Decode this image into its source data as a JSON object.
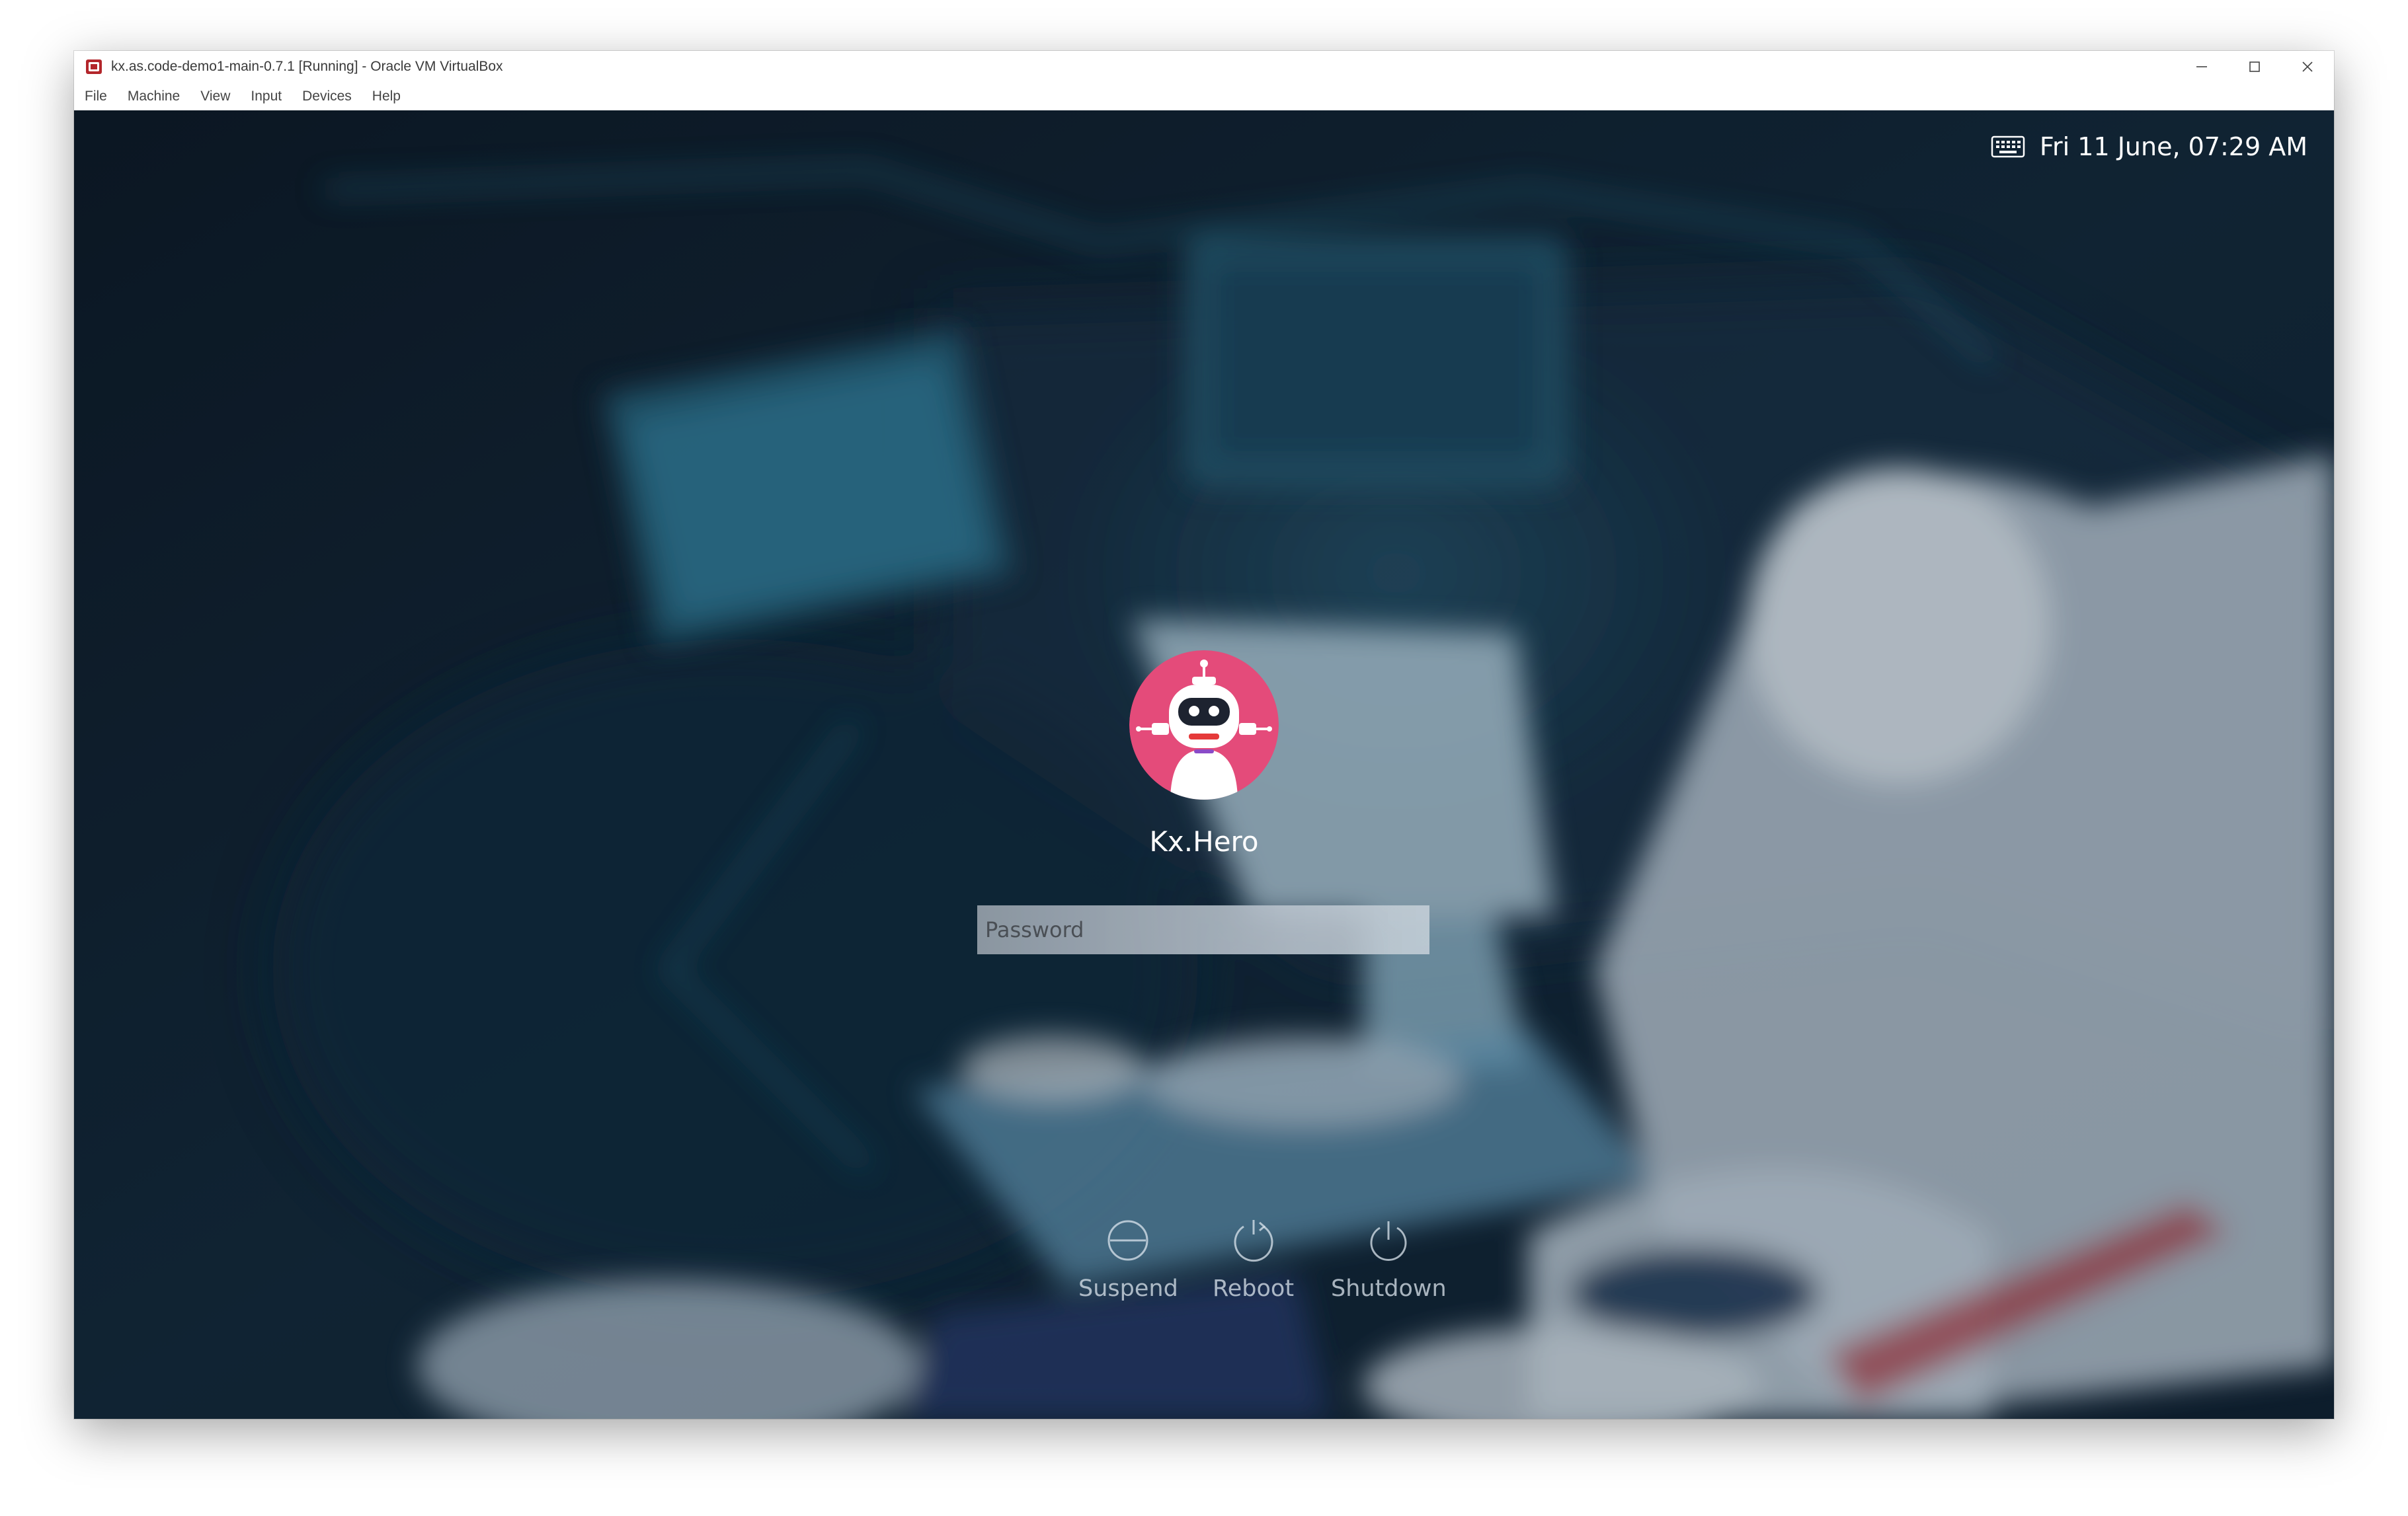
{
  "window": {
    "title": "kx.as.code-demo1-main-0.7.1 [Running] - Oracle VM VirtualBox",
    "app_icon": "virtualbox-icon",
    "controls": [
      "minimize-icon",
      "maximize-icon",
      "close-icon"
    ]
  },
  "menubar": {
    "items": [
      {
        "label": "File"
      },
      {
        "label": "Machine"
      },
      {
        "label": "View"
      },
      {
        "label": "Input"
      },
      {
        "label": "Devices"
      },
      {
        "label": "Help"
      }
    ]
  },
  "status": {
    "keyboard_icon": "keyboard-icon",
    "datetime": "Fri 11 June,  07:29 AM"
  },
  "login": {
    "avatar_icon": "robot-avatar-icon",
    "username": "Kx.Hero",
    "password_placeholder": "Password",
    "password_value": ""
  },
  "power": {
    "suspend_label": "Suspend",
    "reboot_label": "Reboot",
    "shutdown_label": "Shutdown"
  },
  "colors": {
    "background": "#0f1c28",
    "avatar_bg": "#e44b7a",
    "text": "#ffffff"
  }
}
